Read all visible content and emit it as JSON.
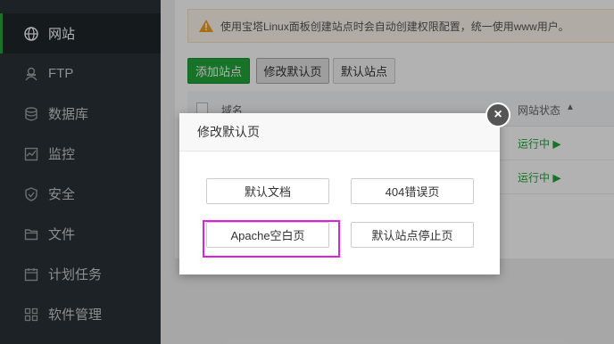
{
  "sidebar": {
    "items": [
      {
        "label": "网站",
        "icon": "globe-icon",
        "active": true
      },
      {
        "label": "FTP",
        "icon": "user-ftp-icon",
        "active": false
      },
      {
        "label": "数据库",
        "icon": "database-icon",
        "active": false
      },
      {
        "label": "监控",
        "icon": "monitor-icon",
        "active": false
      },
      {
        "label": "安全",
        "icon": "shield-icon",
        "active": false
      },
      {
        "label": "文件",
        "icon": "folder-icon",
        "active": false
      },
      {
        "label": "计划任务",
        "icon": "calendar-icon",
        "active": false
      },
      {
        "label": "软件管理",
        "icon": "apps-grid-icon",
        "active": false
      }
    ]
  },
  "notice": {
    "text": "使用宝塔Linux面板创建站点时会自动创建权限配置，统一使用www用户。"
  },
  "toolbar": {
    "add_site": "添加站点",
    "modify_default_page": "修改默认页",
    "default_site": "默认站点"
  },
  "table": {
    "col_domain": "域名",
    "col_status": "网站状态",
    "rows": [
      {
        "status": "运行中 ▶"
      },
      {
        "status": "运行中 ▶"
      }
    ]
  },
  "modal": {
    "title": "修改默认页",
    "close": "×",
    "buttons": {
      "default_doc": "默认文档",
      "error_404": "404错误页",
      "apache_blank": "Apache空白页",
      "default_stop": "默认站点停止页"
    }
  },
  "colors": {
    "accent": "#20a53a",
    "sidebar_bg": "#293135",
    "highlight": "#e020e0"
  }
}
